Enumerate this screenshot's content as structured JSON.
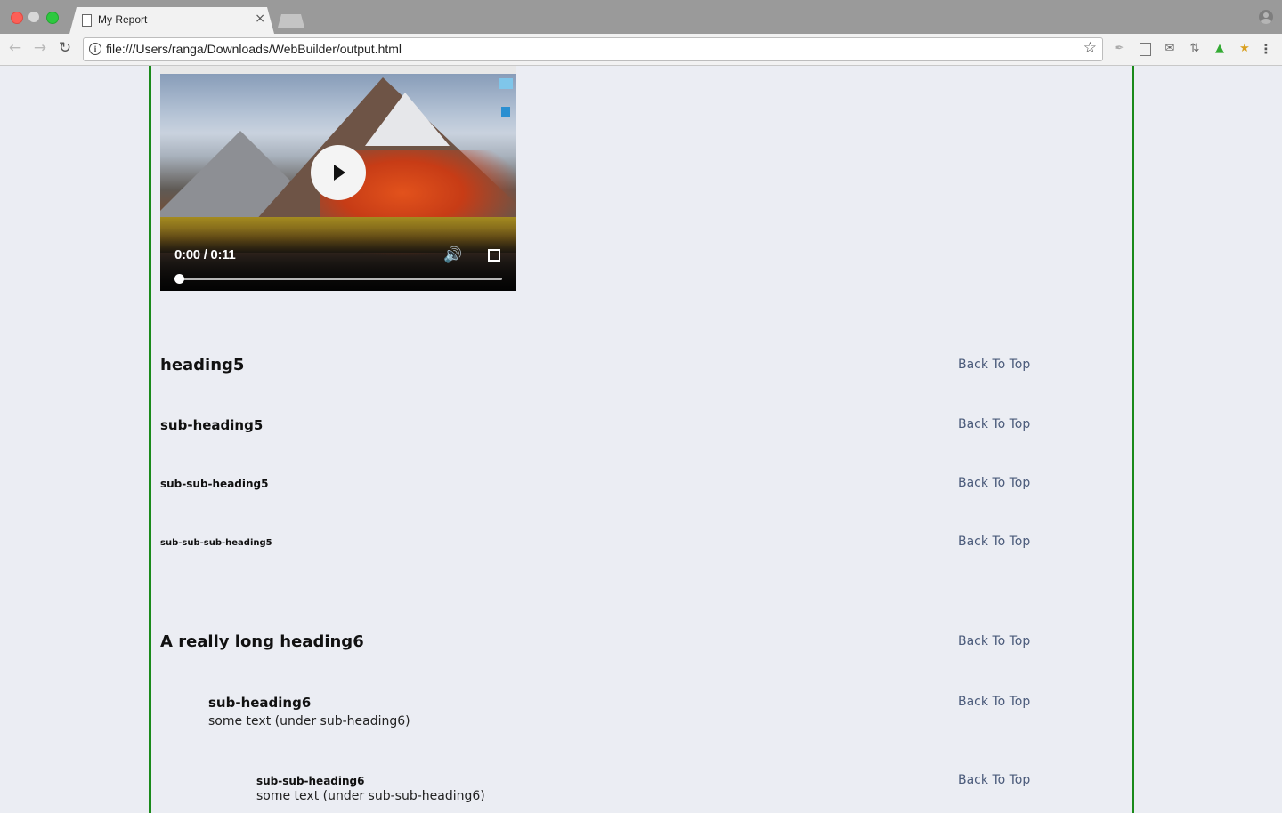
{
  "browser": {
    "tab_title": "My Report",
    "tab_close": "×",
    "url": "file:///Users/ranga/Downloads/WebBuilder/output.html",
    "icons": {
      "back": "arrow-left",
      "forward": "arrow-right",
      "reload": "reload",
      "info": "info-circle",
      "bookmark": "star-outline",
      "menu": "vertical-ellipsis"
    }
  },
  "video": {
    "time": "0:00 / 0:11",
    "progress": 0.0
  },
  "sections": [
    {
      "heading": "heading5",
      "back": "Back To Top"
    },
    {
      "heading": "sub-heading5",
      "back": "Back To Top"
    },
    {
      "heading": "sub-sub-heading5",
      "back": "Back To Top"
    },
    {
      "heading": "sub-sub-sub-heading5",
      "back": "Back To Top"
    },
    {
      "heading": "A really long heading6",
      "back": "Back To Top"
    },
    {
      "heading": "sub-heading6",
      "text": "some text (under sub-heading6)",
      "back": "Back To Top"
    },
    {
      "heading": "sub-sub-heading6",
      "text": "some text (under sub-sub-heading6)",
      "back": "Back To Top"
    }
  ],
  "colors": {
    "page_background": "#ebedf3",
    "container_border": "#1a8a1a",
    "link": "#4a5a7a"
  }
}
